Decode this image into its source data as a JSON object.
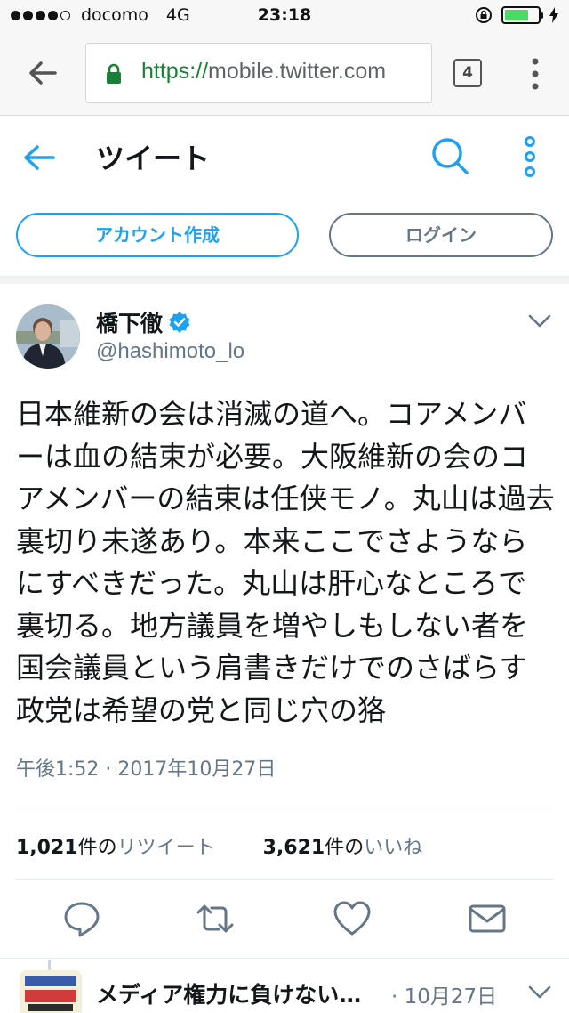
{
  "status_bar": {
    "carrier": "docomo",
    "network": "4G",
    "time": "23:18"
  },
  "browser": {
    "url_scheme": "https://",
    "url_host": "mobile.twitter.com",
    "tab_count": "4"
  },
  "header": {
    "title": "ツイート"
  },
  "account": {
    "create_label": "アカウント作成",
    "login_label": "ログイン"
  },
  "tweet": {
    "author_name": "橋下徹",
    "handle": "@hashimoto_lo",
    "text": "日本維新の会は消滅の道へ。コアメンバーは血の結束が必要。大阪維新の会のコアメンバーの結束は任侠モノ。丸山は過去裏切り未遂あり。本来ここでさようならにすべきだった。丸山は肝心なところで裏切る。地方議員を増やしもしない者を国会議員という肩書きだけでのさばらす政党は希望の党と同じ穴の狢",
    "timestamp": "午後1:52 · 2017年10月27日",
    "retweet_count": "1,021",
    "retweet_label": "件のリツイート",
    "retweet_unit": "件の",
    "retweet_word": "リツイート",
    "like_count": "3,621",
    "like_unit": "件の",
    "like_word": "いいね"
  },
  "next_tweet": {
    "title": "メディア権力に負けない…",
    "date": "· 10月27日"
  },
  "colors": {
    "twitter_blue": "#1da1f2",
    "secondary_text": "#657786",
    "secure_green": "#188038"
  }
}
